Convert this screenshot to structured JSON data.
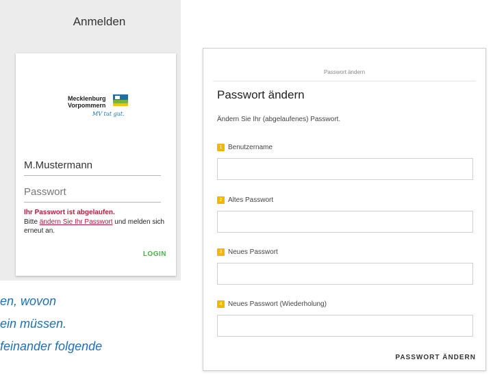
{
  "login": {
    "title": "Anmelden",
    "logo": {
      "line1": "Mecklenburg",
      "line2": "Vorpommern",
      "slogan": "MV tut gut.",
      "colors": {
        "blue": "#1e6fa8",
        "green": "#7bb43c",
        "yellow": "#f5c400"
      }
    },
    "username_value": "M.Mustermann",
    "password_placeholder": "Passwort",
    "error_title": "Ihr Passwort ist abgelaufen.",
    "error_prefix": "Bitte ",
    "error_link": "ändern Sie Ihr Passwort",
    "error_suffix": " und melden sich erneut an.",
    "login_button": "LOGIN"
  },
  "captions": {
    "line1": "en, wovon",
    "line2": "ein müssen.",
    "line3": "feinander folgende"
  },
  "password_change": {
    "breadcrumb": "Passwort ändern",
    "title": "Passwort ändern",
    "description": "Ändern Sie Ihr (abgelaufenes) Passwort.",
    "fields": [
      {
        "number": "1",
        "label": "Benutzername",
        "value": ""
      },
      {
        "number": "2",
        "label": "Altes Passwort",
        "value": ""
      },
      {
        "number": "3",
        "label": "Neues Passwort",
        "value": ""
      },
      {
        "number": "4",
        "label": "Neues Passwort (Wiederholung)",
        "value": ""
      }
    ],
    "submit_button": "PASSWORT ÄNDERN"
  },
  "colors": {
    "error": "#b8193b",
    "login_green": "#4caf50",
    "step_badge": "#f2b705",
    "caption_blue": "#1e6fb8"
  }
}
